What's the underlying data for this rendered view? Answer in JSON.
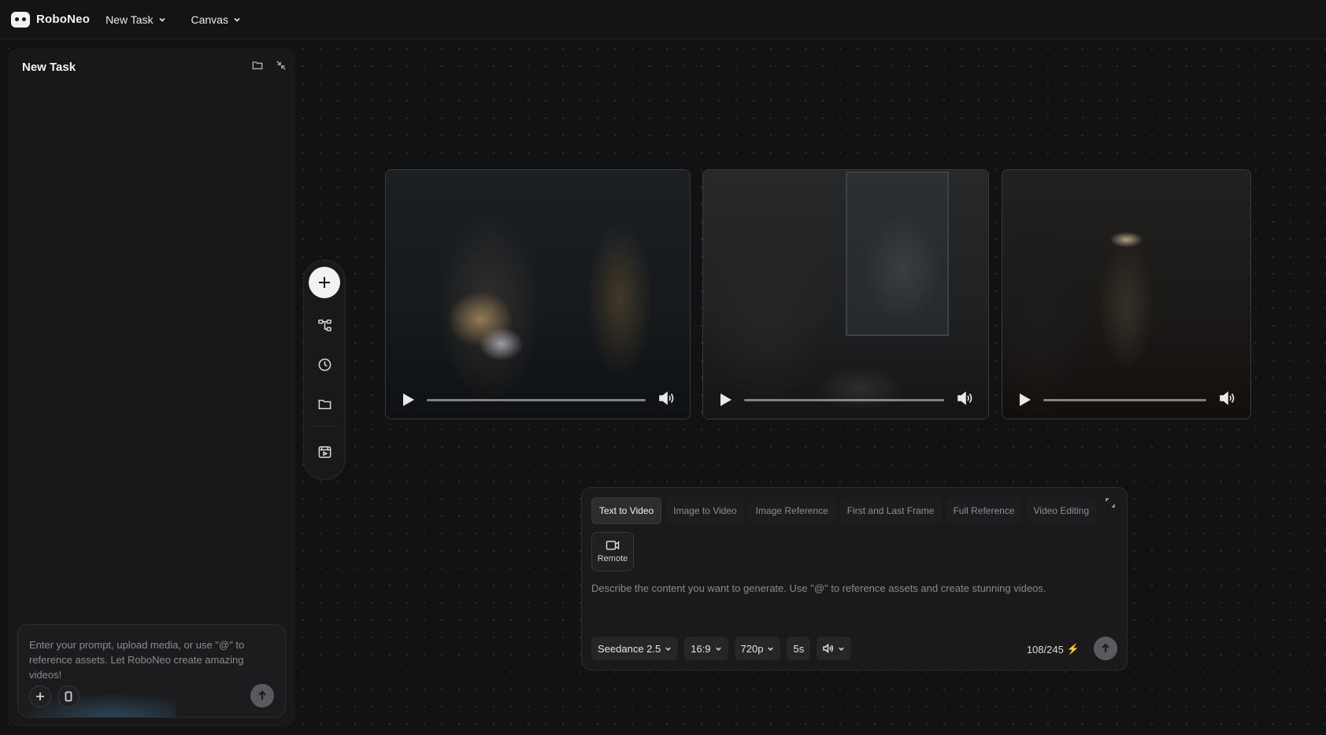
{
  "app": {
    "name": "RoboNeo"
  },
  "topnav": {
    "task_menu": "New Task",
    "canvas_menu": "Canvas"
  },
  "side_panel": {
    "title": "New Task",
    "prompt_placeholder": "Enter your prompt, upload media, or use \"@\" to reference assets. Let RoboNeo create amazing videos!"
  },
  "toolbar": {
    "items": [
      "add-icon",
      "workflow-icon",
      "history-icon",
      "folder-icon",
      "video-frame-icon"
    ]
  },
  "videos": [
    {
      "name": "video-clip-1",
      "progress": 0
    },
    {
      "name": "video-clip-2",
      "progress": 0
    },
    {
      "name": "video-clip-3",
      "progress": 0
    }
  ],
  "generator": {
    "tabs": [
      "Text to Video",
      "Image to Video",
      "Image Reference",
      "First and Last Frame",
      "Full Reference",
      "Video Editing"
    ],
    "active_tab": "Text to Video",
    "remote_label": "Remote",
    "description": "Describe the content you want to generate. Use \"@\" to reference assets and create stunning videos.",
    "model": "Seedance 2.5",
    "aspect_ratio": "16:9",
    "resolution": "720p",
    "duration": "5s",
    "credits": "108/245"
  },
  "colors": {
    "background": "#121213",
    "panel": "#181819",
    "accent_bolt": "#ff8a2a"
  }
}
